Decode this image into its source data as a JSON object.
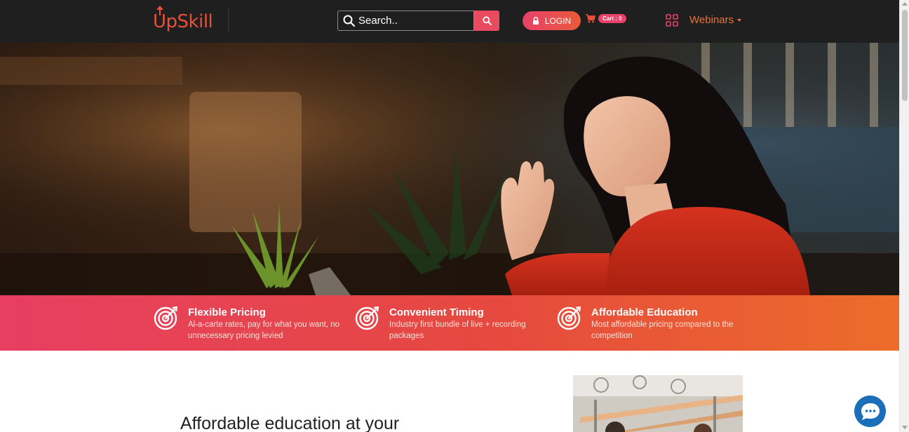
{
  "header": {
    "logo_text": "UpSkill",
    "search": {
      "placeholder": "Search.."
    },
    "login_label": "LOGIN",
    "cart_label": "Cart : 0",
    "webinars_label": "Webinars"
  },
  "features": [
    {
      "title": "Flexible Pricing",
      "description": "Al-a-carte rates, pay for what you want, no unnecessary pricing levied"
    },
    {
      "title": "Convenient Timing",
      "description": "Industry first bundle of live + recording packages"
    },
    {
      "title": "Affordable Education",
      "description": "Most affordable pricing compared to the competition"
    }
  ],
  "main": {
    "heading": "Affordable education at your"
  },
  "colors": {
    "header_bg": "#1f1f1f",
    "brand_orange": "#e8503a",
    "accent_pink": "#e8416a",
    "band_start": "#e73e62",
    "band_end": "#ec6d2a",
    "chat_blue": "#1a6fb8"
  },
  "icons": {
    "search": "search-icon",
    "lock": "lock-icon",
    "cart": "cart-icon",
    "grid": "grid-icon",
    "target": "target-icon",
    "chat": "chat-bubble-icon"
  }
}
